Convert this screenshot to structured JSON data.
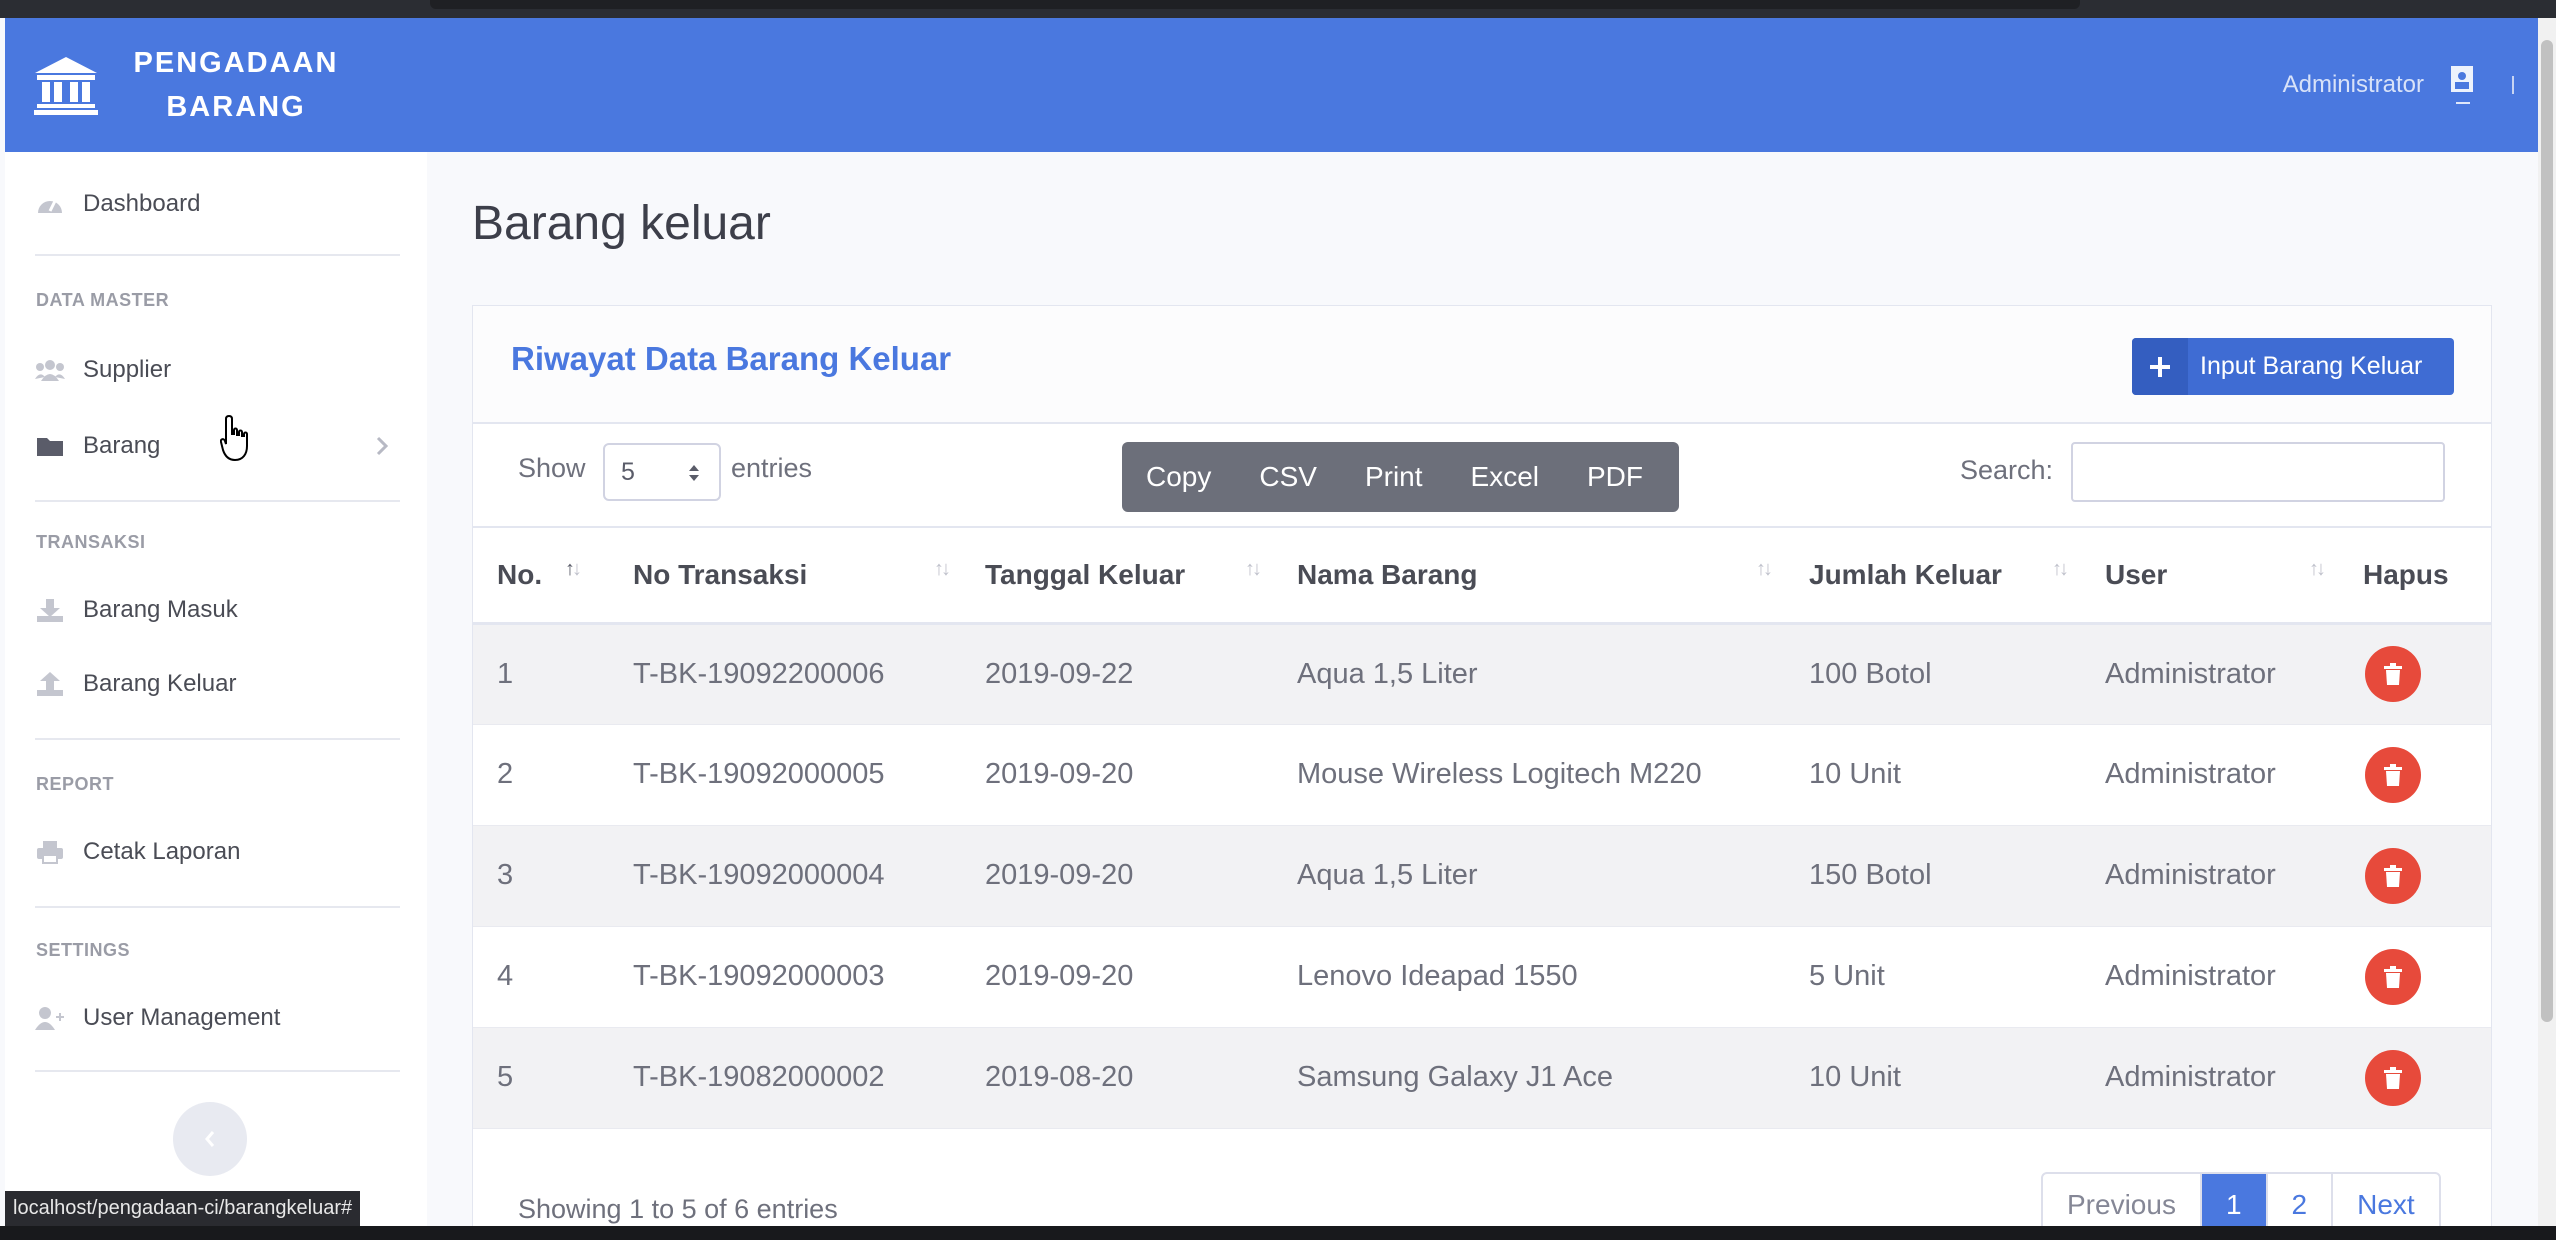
{
  "brand": {
    "line1": "PENGADAAN",
    "line2": "BARANG",
    "icon": "bank-icon"
  },
  "user": {
    "name": "Administrator",
    "avatar_icon": "user-avatar-icon"
  },
  "sidebar": {
    "dashboard": "Dashboard",
    "headings": {
      "master": "DATA MASTER",
      "transaksi": "TRANSAKSI",
      "report": "REPORT",
      "settings": "SETTINGS"
    },
    "items": {
      "supplier": "Supplier",
      "barang": "Barang",
      "barang_masuk": "Barang Masuk",
      "barang_keluar": "Barang Keluar",
      "cetak_laporan": "Cetak Laporan",
      "user_management": "User Management"
    }
  },
  "status_url": "localhost/pengadaan-ci/barangkeluar#",
  "page": {
    "title": "Barang keluar"
  },
  "card": {
    "title": "Riwayat Data Barang Keluar",
    "input_button": "Input Barang Keluar"
  },
  "controls": {
    "show_label": "Show",
    "show_value": "5",
    "entries_label": "entries",
    "buttons": {
      "copy": "Copy",
      "csv": "CSV",
      "print": "Print",
      "excel": "Excel",
      "pdf": "PDF"
    },
    "search_label": "Search:",
    "search_value": ""
  },
  "table": {
    "headers": [
      "No.",
      "No Transaksi",
      "Tanggal Keluar",
      "Nama Barang",
      "Jumlah Keluar",
      "User",
      "Hapus"
    ],
    "rows": [
      [
        "1",
        "T-BK-19092200006",
        "2019-09-22",
        "Aqua 1,5 Liter",
        "100 Botol",
        "Administrator"
      ],
      [
        "2",
        "T-BK-19092000005",
        "2019-09-20",
        "Mouse Wireless Logitech M220",
        "10 Unit",
        "Administrator"
      ],
      [
        "3",
        "T-BK-19092000004",
        "2019-09-20",
        "Aqua 1,5 Liter",
        "150 Botol",
        "Administrator"
      ],
      [
        "4",
        "T-BK-19092000003",
        "2019-09-20",
        "Lenovo Ideapad 1550",
        "5 Unit",
        "Administrator"
      ],
      [
        "5",
        "T-BK-19082000002",
        "2019-08-20",
        "Samsung Galaxy J1 Ace",
        "10 Unit",
        "Administrator"
      ]
    ]
  },
  "footer": {
    "showing": "Showing 1 to 5 of 6 entries",
    "pagination": {
      "previous": "Previous",
      "page1": "1",
      "page2": "2",
      "next": "Next"
    }
  },
  "colors": {
    "primary": "#4a78df",
    "danger": "#e74a3b",
    "button_group": "#6c6f7a"
  }
}
